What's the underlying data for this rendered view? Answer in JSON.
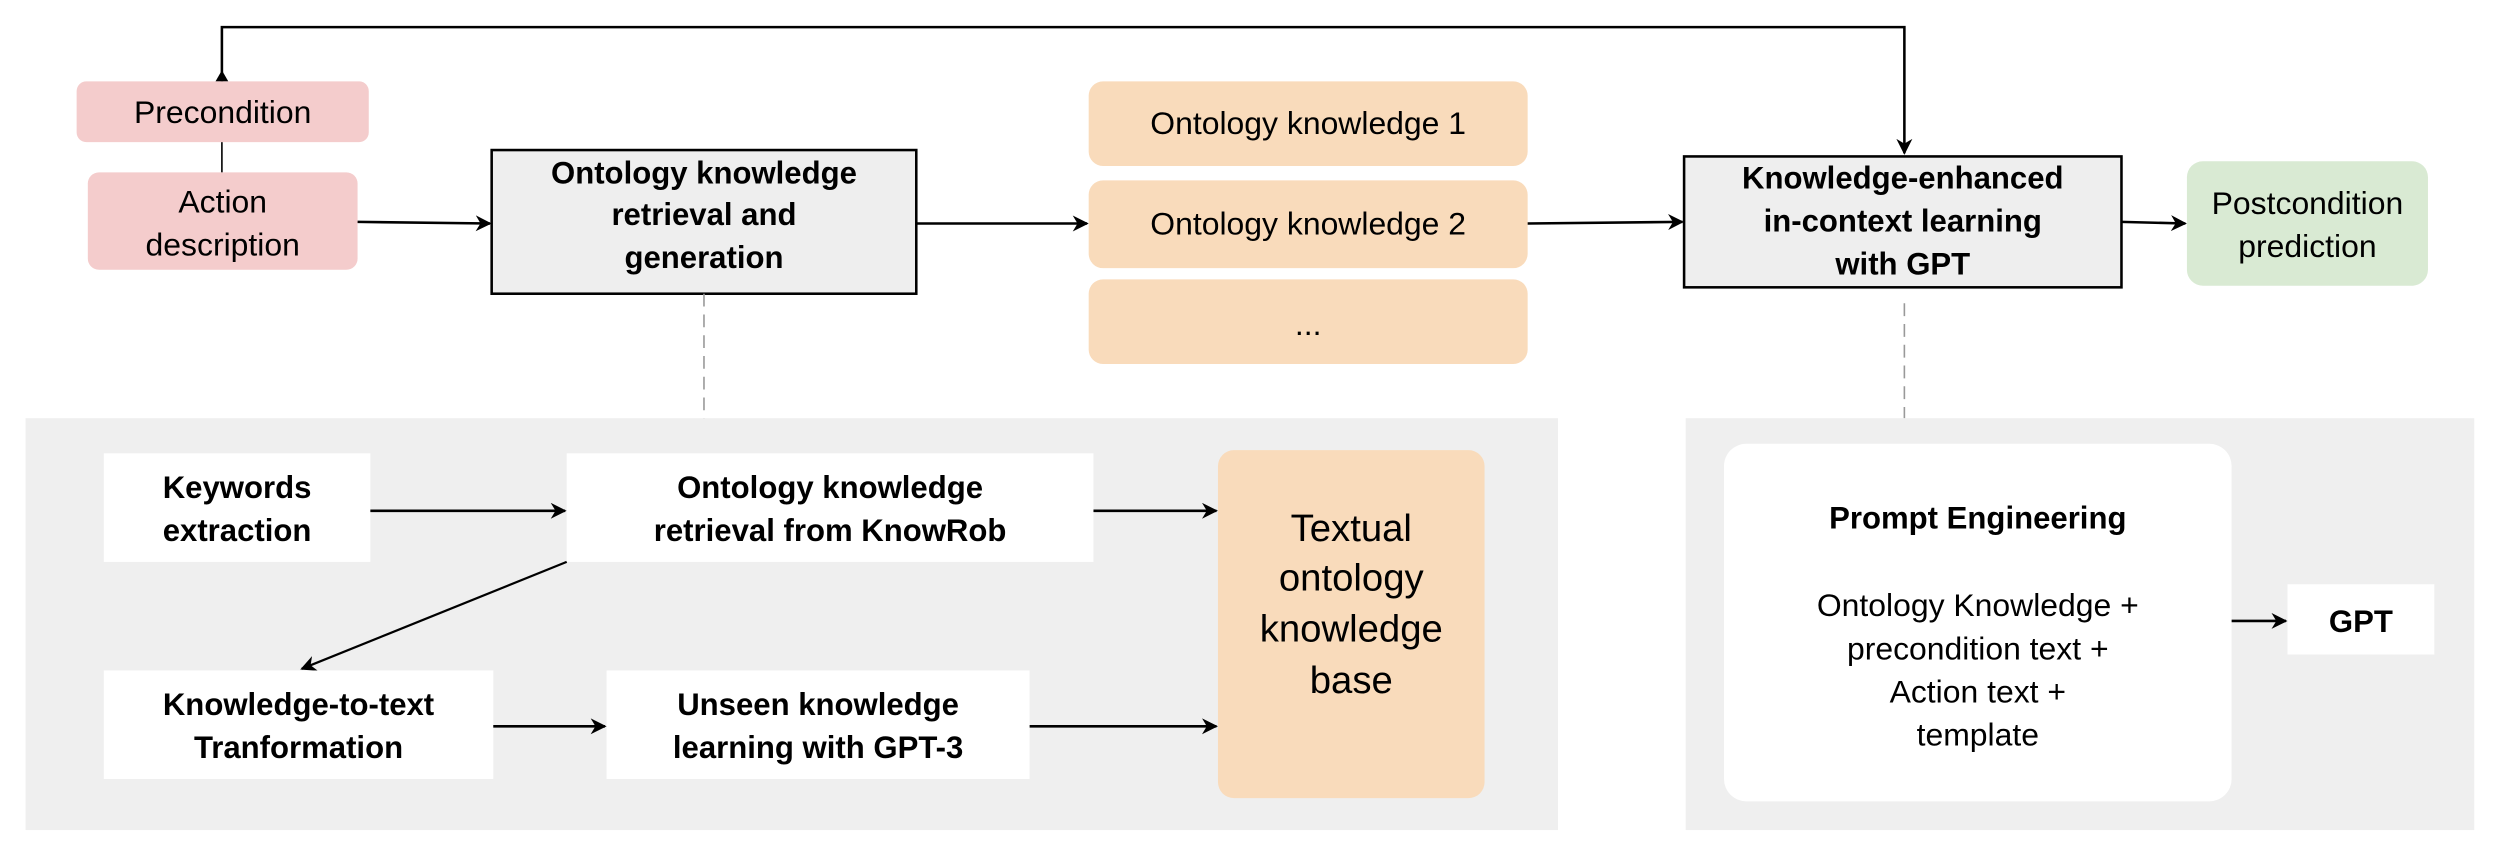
{
  "inputs": {
    "precondition": "Precondition",
    "action": [
      "Action",
      "description"
    ]
  },
  "retrieval_box": [
    "Ontology knowledge",
    "retrieval and",
    "generation"
  ],
  "knowledge_items": [
    "Ontology knowledge 1",
    "Ontology knowledge 2",
    "..."
  ],
  "icl_box": [
    "Knowledge-enhanced",
    "in-context learning",
    "with GPT"
  ],
  "output": [
    "Postcondition",
    "prediction"
  ],
  "left_panel": {
    "keywords": [
      "Keywords",
      "extraction"
    ],
    "knowrob": [
      "Ontology knowledge",
      "retrieval from KnowRob"
    ],
    "k2t": [
      "Knowledge-to-text",
      "Tranformation"
    ],
    "unseen": [
      "Unseen knowledge",
      "learning with GPT-3"
    ],
    "kb": [
      "Textual",
      "ontology",
      "knowledge",
      "base"
    ]
  },
  "right_panel": {
    "title": "Prompt Engineering",
    "lines": [
      "Ontology  Knowledge +",
      "precondition text +",
      "Action text +",
      "template"
    ],
    "gpt": "GPT"
  },
  "colors": {
    "input": "#f4cccc",
    "knowledge": "#f9dbbb",
    "output": "#d9ead3",
    "panel": "#efefef",
    "process_box": "#eeeeee"
  }
}
